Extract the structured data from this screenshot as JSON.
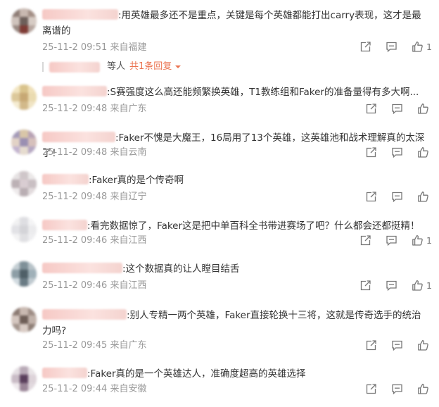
{
  "comments": [
    {
      "text": ":用英雄最多还不是重点，关键是每个英雄都能打出carry表现，这才是最离谱的",
      "time": "25-11-2 09:51",
      "location": "来自福建",
      "likes": "1",
      "reply": {
        "suffix": "等人",
        "link": "共1条回复"
      }
    },
    {
      "text": ":S赛强度这么高还能频繁换英雄，T1教练组和Faker的准备量得有多大啊...",
      "time": "25-11-2 09:48",
      "location": "来自广东",
      "likes": ""
    },
    {
      "text": ":Faker不愧是大魔王，16局用了13个英雄，这英雄池和战术理解真的太深了！",
      "time": "25-11-2 09:48",
      "location": "来自云南",
      "likes": ""
    },
    {
      "text": ":Faker真的是个传奇啊",
      "time": "25-11-2 09:48",
      "location": "来自辽宁",
      "likes": ""
    },
    {
      "text": ":看完数据惊了，Faker这是把中单百科全书带进赛场了吧？什么都会还都挺精！",
      "time": "25-11-2 09:46",
      "location": "来自江西",
      "likes": "1"
    },
    {
      "text": ":这个数据真的让人瞠目结舌",
      "time": "25-11-2 09:46",
      "location": "来自江西",
      "likes": "1"
    },
    {
      "text": ":别人专精一两个英雄，Faker直接轮换十三将，这就是传奇选手的统治力吗?",
      "time": "25-11-2 09:45",
      "location": "来自广东",
      "likes": ""
    },
    {
      "text": ":Faker真的是一个英雄达人，准确度超高的英雄选择",
      "time": "25-11-2 09:44",
      "location": "来自安徽",
      "likes": ""
    }
  ],
  "icons": {
    "share": "share-icon",
    "comment": "comment-icon",
    "like": "like-icon",
    "chevron": "chevron-down-icon"
  },
  "colors": {
    "accent": "#eb7350",
    "meta": "#999999",
    "text": "#333333"
  }
}
